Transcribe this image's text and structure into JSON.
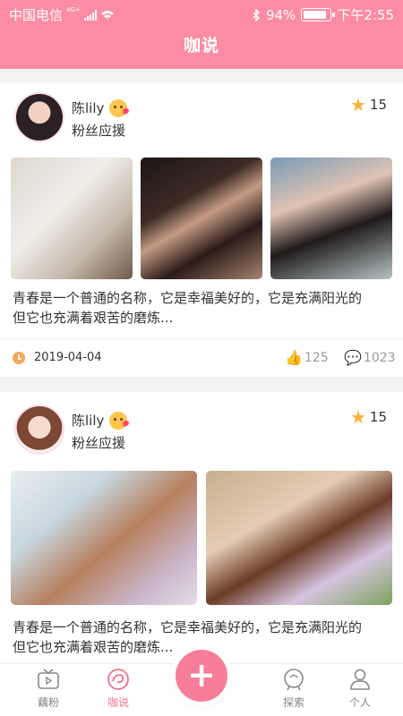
{
  "status_bar": {
    "carrier": "中国电信",
    "network": "4G+",
    "battery": "94%",
    "battery_level": 0.94,
    "time": "下午2:55"
  },
  "header": {
    "title": "咖说"
  },
  "posts": [
    {
      "author": "陈lily",
      "subtitle": "粉丝应援",
      "stars": "15",
      "text_line1": "青春是一个普通的名称，它是幸福美好的，它是充满阳光的",
      "text_line2": "但它也充满着艰苦的磨炼...",
      "date": "2019-04-04",
      "likes": "125",
      "comments": "1023"
    },
    {
      "author": "陈lily",
      "subtitle": "粉丝应援",
      "stars": "15",
      "text_line1": "青春是一个普通的名称，它是幸福美好的，它是充满阳光的",
      "text_line2": "但它也充满着艰苦的磨炼..."
    }
  ],
  "bottom_nav": {
    "items": [
      {
        "label": "藕粉",
        "icon": "tv-icon"
      },
      {
        "label": "咖说",
        "icon": "swirl-icon",
        "active": true
      },
      {
        "label": "",
        "icon": "add-icon"
      },
      {
        "label": "探索",
        "icon": "explore-icon"
      },
      {
        "label": "个人",
        "icon": "person-icon"
      }
    ],
    "add_symbol": "+"
  },
  "colors": {
    "accent": "#fb8ca3",
    "star": "#fbb13b",
    "like": "#f4563f"
  }
}
